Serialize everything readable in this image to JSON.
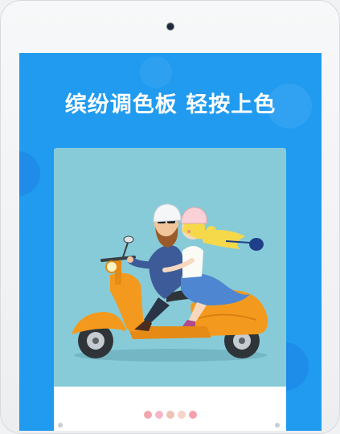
{
  "headline": "缤纷调色板 轻按上色",
  "colors": {
    "screen_bg": "#209bf0",
    "art_bg": "#87cbd8",
    "scooter": "#f39a1e",
    "swatches": [
      "#f2a6ad",
      "#f5b7c8",
      "#f0c2b4",
      "#f7d3c6",
      "#f5a0ab"
    ]
  },
  "icons": [
    "camera-icon",
    "scooter-illustration",
    "left-nav-dot",
    "right-nav-dot"
  ]
}
